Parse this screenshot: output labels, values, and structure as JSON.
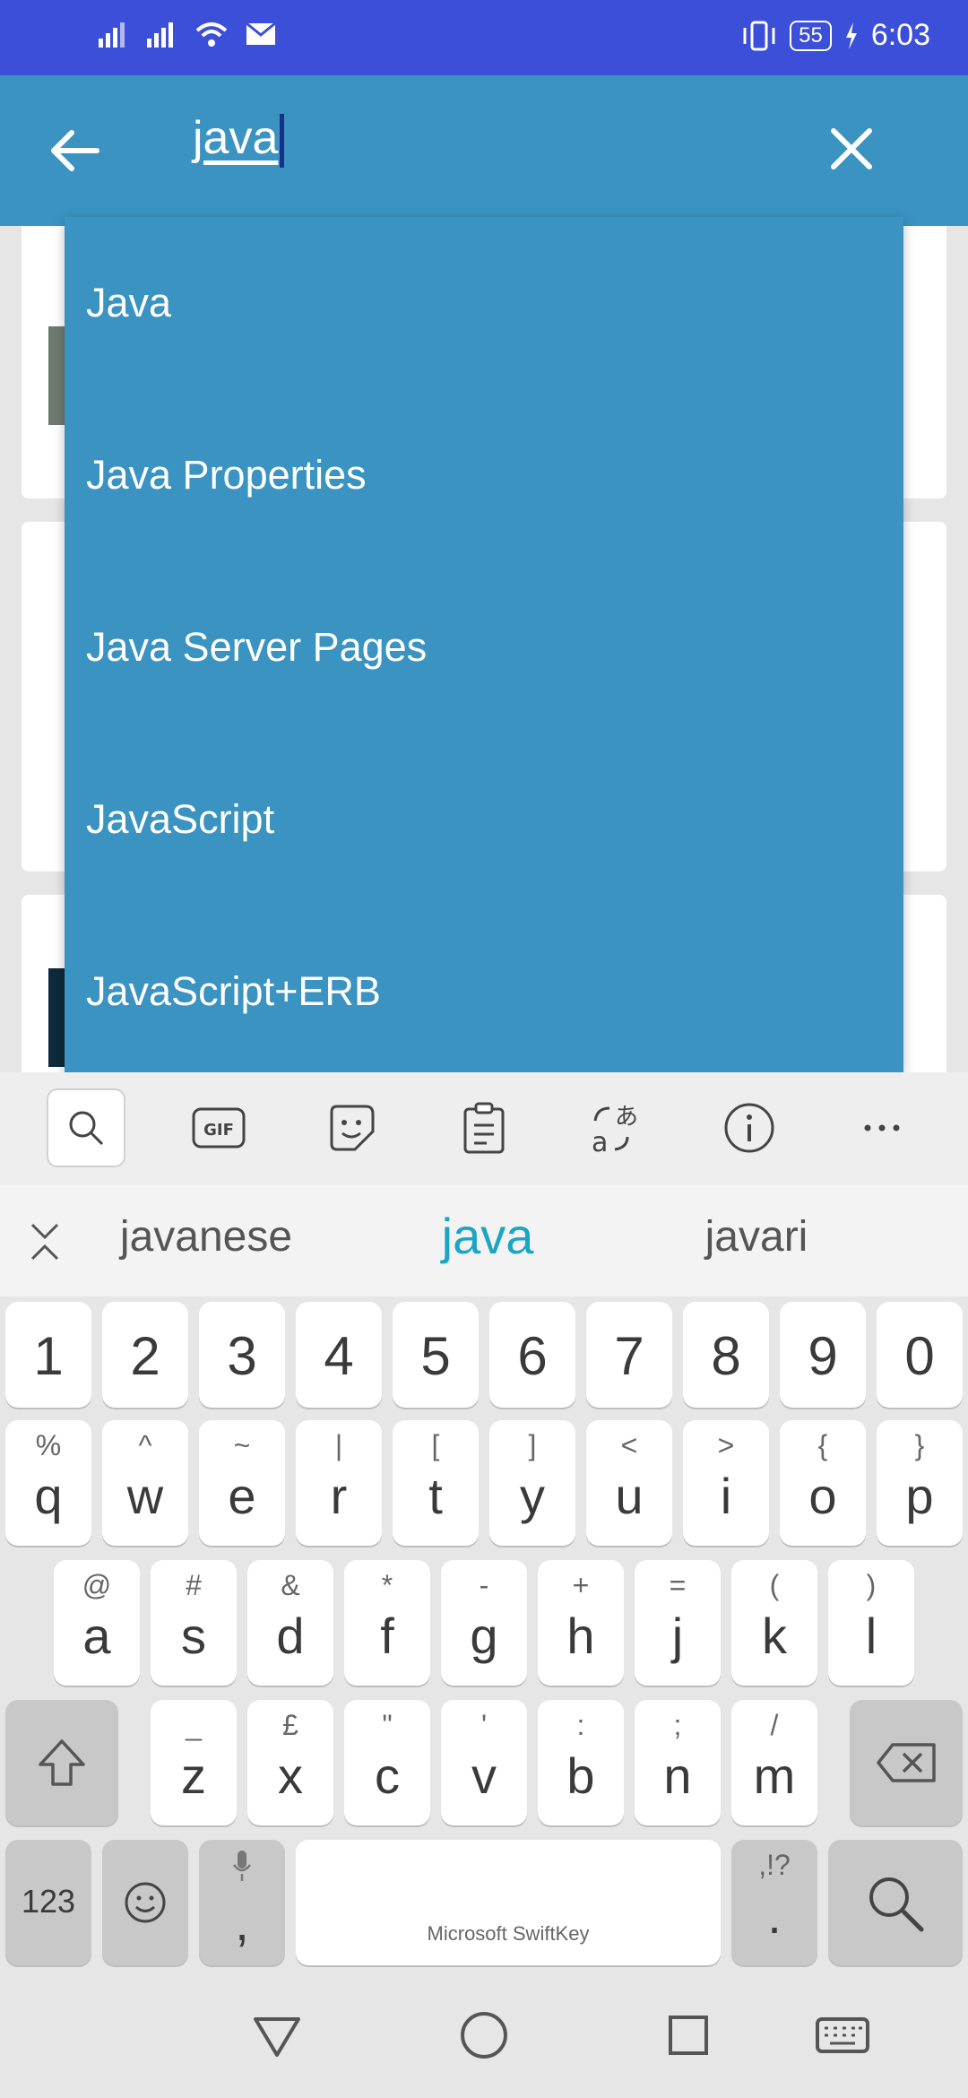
{
  "status_bar": {
    "battery": "55",
    "time": "6:03"
  },
  "search": {
    "query": "java"
  },
  "dropdown": {
    "items": [
      "Java",
      "Java Properties",
      "Java Server Pages",
      "JavaScript",
      "JavaScript+ERB"
    ]
  },
  "keyboard": {
    "suggestions": [
      "javanese",
      "java",
      "javari"
    ],
    "number_row": [
      "1",
      "2",
      "3",
      "4",
      "5",
      "6",
      "7",
      "8",
      "9",
      "0"
    ],
    "row1": [
      [
        "q",
        "%"
      ],
      [
        "w",
        "^"
      ],
      [
        "e",
        "~"
      ],
      [
        "r",
        "|"
      ],
      [
        "t",
        "["
      ],
      [
        "y",
        "]"
      ],
      [
        "u",
        "<"
      ],
      [
        "i",
        ">"
      ],
      [
        "o",
        "{"
      ],
      [
        "p",
        "}"
      ]
    ],
    "row2": [
      [
        "a",
        "@"
      ],
      [
        "s",
        "#"
      ],
      [
        "d",
        "&"
      ],
      [
        "f",
        "*"
      ],
      [
        "g",
        "-"
      ],
      [
        "h",
        "+"
      ],
      [
        "j",
        "="
      ],
      [
        "k",
        "("
      ],
      [
        "l",
        ")"
      ]
    ],
    "row3": [
      [
        "z",
        "_"
      ],
      [
        "x",
        "£"
      ],
      [
        "c",
        "\""
      ],
      [
        "v",
        "'"
      ],
      [
        "b",
        ":"
      ],
      [
        "n",
        ";"
      ],
      [
        "m",
        "/"
      ]
    ],
    "num_toggle": "123",
    "comma": ",",
    "space_label": "Microsoft SwiftKey",
    "period": ".",
    "period_sub": ",!?"
  }
}
